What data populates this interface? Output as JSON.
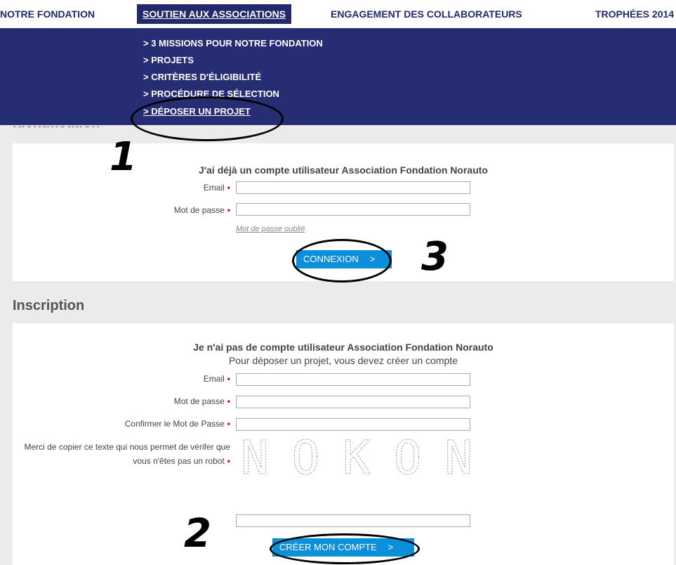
{
  "nav": {
    "items": [
      "NOTRE FONDATION",
      "SOUTIEN AUX ASSOCIATIONS",
      "ENGAGEMENT DES COLLABORATEURS",
      "TROPHÉES 2014"
    ]
  },
  "dropdown": {
    "items": [
      "> 3 MISSIONS POUR NOTRE FONDATION",
      "> PROJETS",
      "> CRITÈRES D'ÉLIGIBILITÉ",
      "> PROCÉDURE DE SÉLECTION",
      "> DÉPOSER UN PROJET"
    ]
  },
  "identification": {
    "title": "Identification",
    "heading": "J'ai déjà un compte utilisateur Association Fondation Norauto",
    "email_label": "Email",
    "password_label": "Mot de passe",
    "forgot_link": "Mot de passe oublié",
    "submit_label": "CONNEXION",
    "submit_chevron": ">"
  },
  "inscription": {
    "title": "Inscription",
    "heading": "Je n'ai pas de compte utilisateur Association Fondation Norauto",
    "subheading": "Pour déposer un projet, vous devez créer un compte",
    "email_label": "Email",
    "password_label": "Mot de passe",
    "confirm_label": "Confirmer le Mot de Passe",
    "captcha_label": "Merci de copier ce texte qui nous permet de vérifer que vous n'êtes pas un robot",
    "captcha_text": "NOKON",
    "submit_label": "CRÉER MON COMPTE",
    "submit_chevron": ">"
  },
  "required_mark": "•",
  "annotations": [
    "1",
    "2",
    "3"
  ],
  "colors": {
    "navy": "#272d73",
    "button_blue": "#0b8fd8",
    "required_red": "#d0021b"
  }
}
